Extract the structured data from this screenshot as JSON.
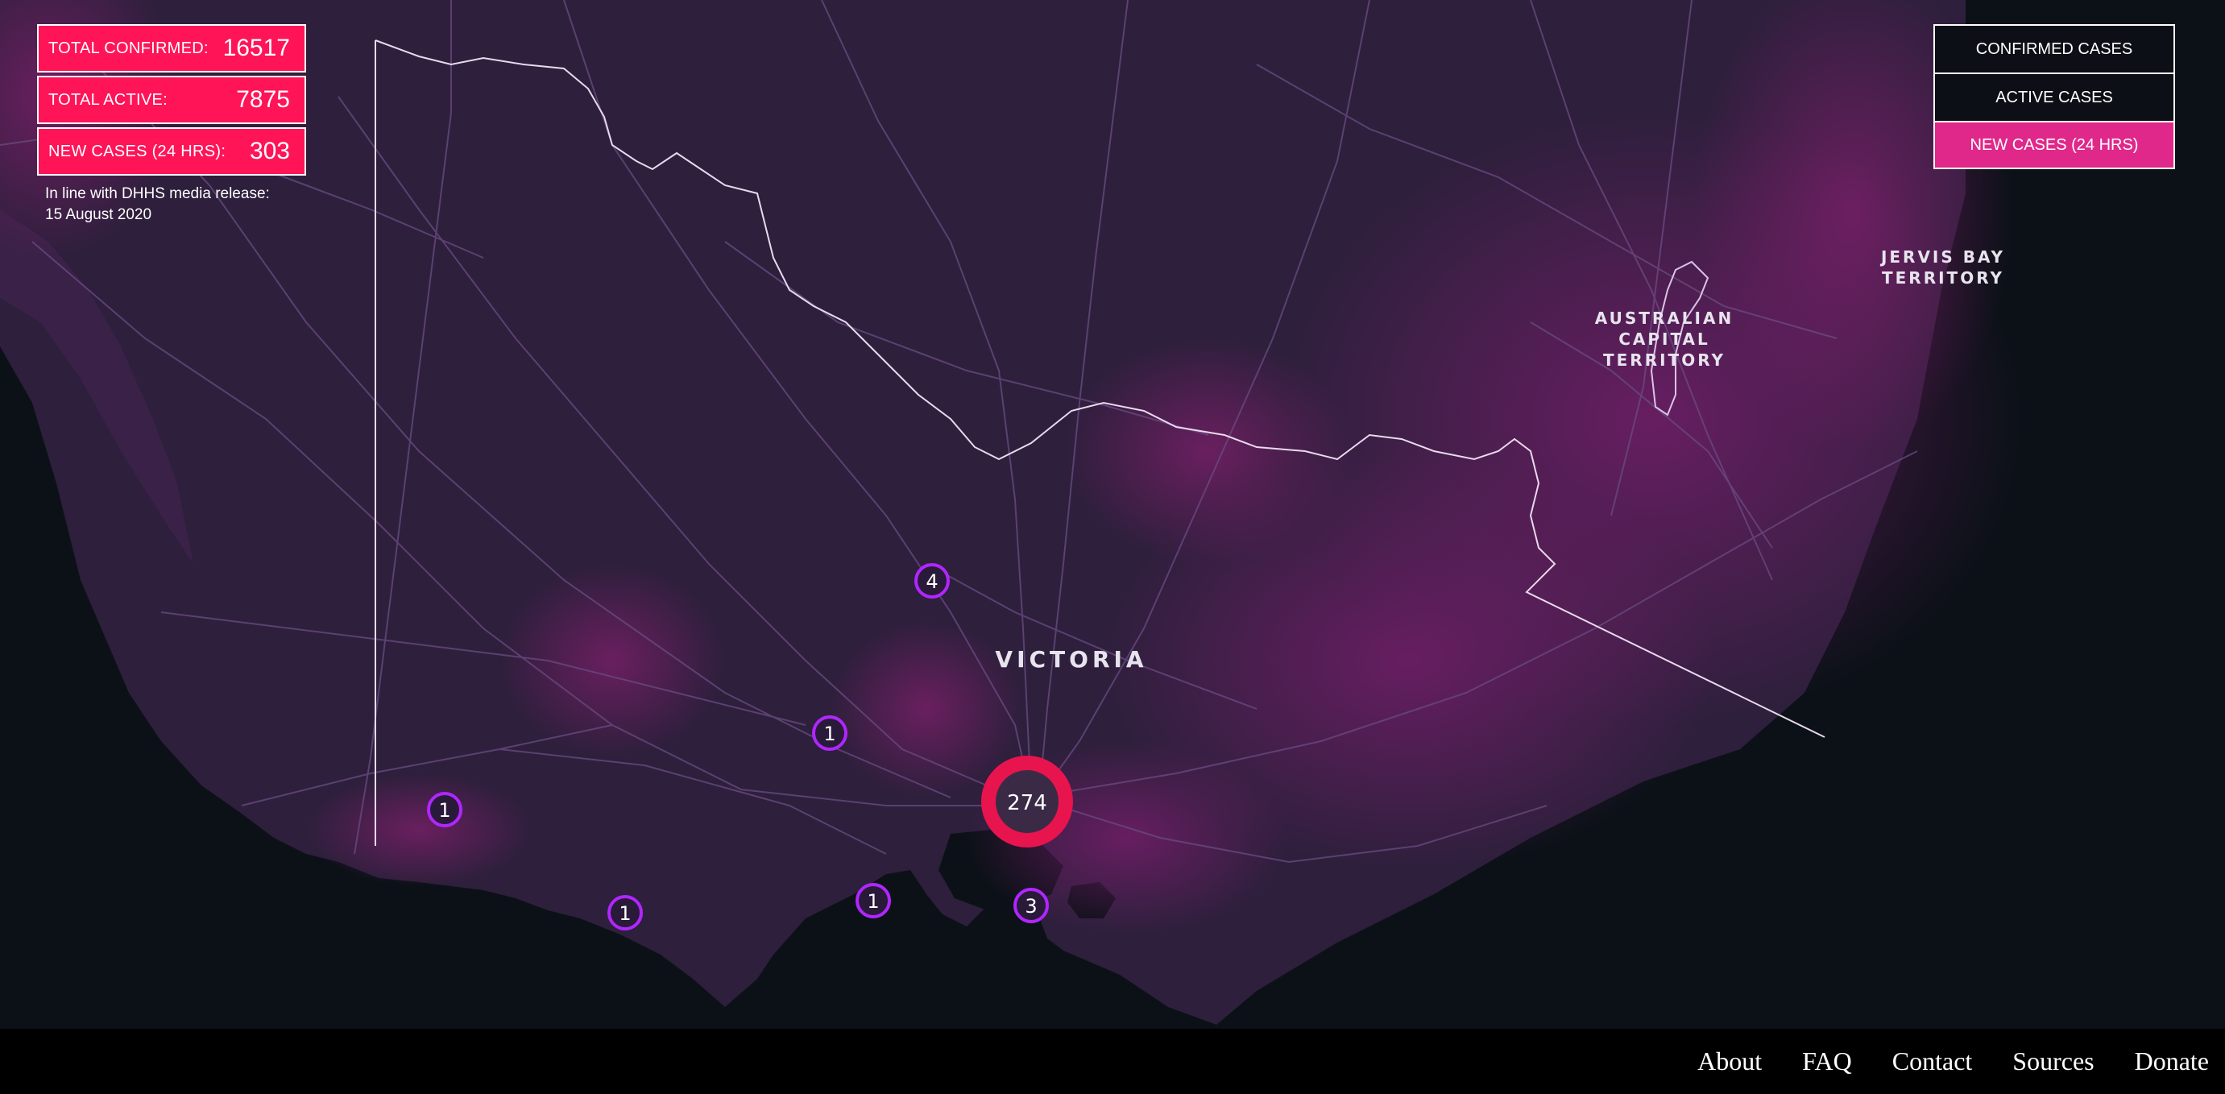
{
  "stats": {
    "total_confirmed_label": "TOTAL CONFIRMED:",
    "total_confirmed_value": "16517",
    "total_active_label": "TOTAL ACTIVE:",
    "total_active_value": "7875",
    "new_cases_label": "NEW CASES (24 HRS):",
    "new_cases_value": "303",
    "media_note_line1": "In line with DHHS media release:",
    "media_note_line2": "15 August 2020"
  },
  "modes": [
    {
      "label": "CONFIRMED CASES",
      "active": false
    },
    {
      "label": "ACTIVE CASES",
      "active": false
    },
    {
      "label": "NEW CASES (24 HRS)",
      "active": true
    }
  ],
  "map": {
    "region_labels": {
      "victoria": "VICTORIA",
      "act": [
        "AUSTRALIAN",
        "CAPITAL",
        "TERRITORY"
      ],
      "jervis": [
        "JERVIS BAY",
        "TERRITORY"
      ]
    },
    "markers": [
      {
        "id": "marker-4",
        "count": "4",
        "kind": "small"
      },
      {
        "id": "marker-1-bendigo",
        "count": "1",
        "kind": "small"
      },
      {
        "id": "marker-1-west",
        "count": "1",
        "kind": "small"
      },
      {
        "id": "marker-1-southwest",
        "count": "1",
        "kind": "small"
      },
      {
        "id": "marker-1-geelong",
        "count": "1",
        "kind": "small"
      },
      {
        "id": "marker-3",
        "count": "3",
        "kind": "small"
      },
      {
        "id": "marker-274",
        "count": "274",
        "kind": "large"
      }
    ]
  },
  "colors": {
    "stat_bg": "#ff1458",
    "active_mode_bg": "#e0288a",
    "marker_ring": "#b026ff",
    "large_marker_ring": "#e8144e",
    "land": "#2e1f3c",
    "land_highlight": "#5a1a55",
    "ocean": "#0c1118"
  },
  "footer": {
    "links": [
      "About",
      "FAQ",
      "Contact",
      "Sources",
      "Donate"
    ]
  }
}
